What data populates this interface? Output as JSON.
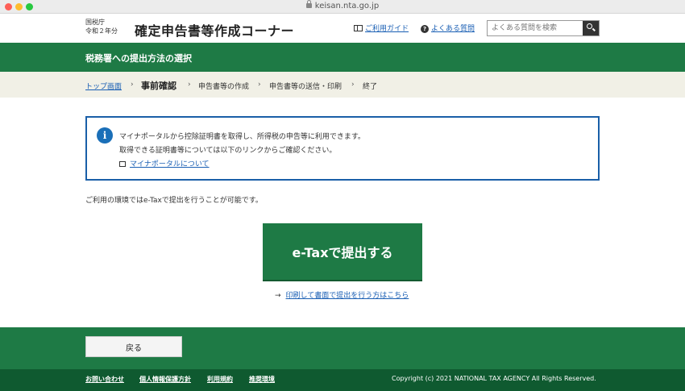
{
  "browser": {
    "url": "keisan.nta.go.jp"
  },
  "header": {
    "agency_line1": "国税庁",
    "agency_line2": "令和２年分",
    "site_title": "確定申告書等作成コーナー",
    "guide_label": "ご利用ガイド",
    "faq_label": "よくある質問",
    "search_placeholder": "よくある質問を検索"
  },
  "page": {
    "title": "税務署への提出方法の選択"
  },
  "breadcrumb": {
    "top": "トップ画面",
    "current": "事前確認",
    "step3": "申告書等の作成",
    "step4": "申告書等の送信・印刷",
    "step5": "終了",
    "separator": "›"
  },
  "info": {
    "line1": "マイナポータルから控除証明書を取得し、所得税の申告等に利用できます。",
    "line2": "取得できる証明書等については以下のリンクからご確認ください。",
    "link": "マイナポータルについて"
  },
  "main": {
    "env_text": "ご利用の環境ではe-Taxで提出を行うことが可能です。",
    "etax_button": "e-Taxで提出する",
    "print_link": "印刷して書面で提出を行う方はこちら"
  },
  "footer": {
    "back_button": "戻る",
    "links": [
      "お問い合わせ",
      "個人情報保護方針",
      "利用規約",
      "推奨環境"
    ],
    "copyright": "Copyright (c) 2021 NATIONAL TAX AGENCY All Rights Reserved."
  },
  "colors": {
    "brand_green": "#1e7a45",
    "footer_dark": "#0f5a30",
    "info_border": "#1a5fa8",
    "link_blue": "#1a5fb4"
  }
}
